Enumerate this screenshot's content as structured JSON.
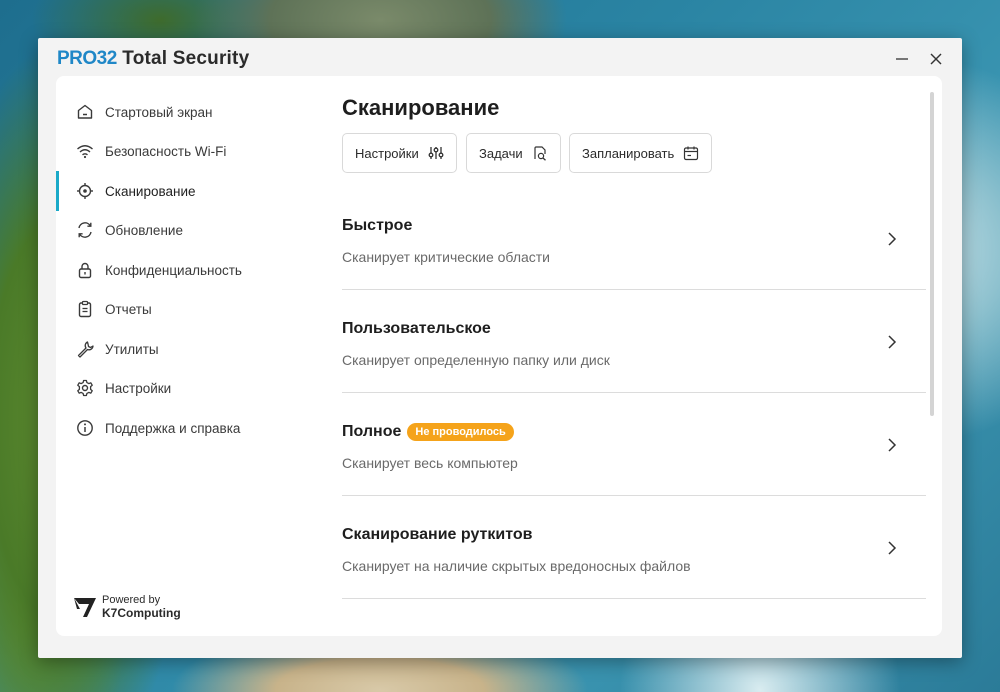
{
  "window": {
    "brand_pro": "PRO32",
    "brand_rest": "Total Security",
    "minimize_label": "—",
    "close_label": "✕"
  },
  "sidebar": {
    "items": [
      {
        "label": "Стартовый экран",
        "icon": "home-icon"
      },
      {
        "label": "Безопасность Wi-Fi",
        "icon": "wifi-icon"
      },
      {
        "label": "Сканирование",
        "icon": "scan-target-icon",
        "active": true
      },
      {
        "label": "Обновление",
        "icon": "refresh-icon"
      },
      {
        "label": "Конфиденциальность",
        "icon": "lock-icon"
      },
      {
        "label": "Отчеты",
        "icon": "clipboard-icon"
      },
      {
        "label": "Утилиты",
        "icon": "wrench-icon"
      },
      {
        "label": "Настройки",
        "icon": "gear-icon"
      },
      {
        "label": "Поддержка и справка",
        "icon": "info-icon"
      }
    ],
    "powered_by": "Powered by",
    "powered_company": "K7Computing"
  },
  "main": {
    "title": "Сканирование",
    "toolbar": {
      "settings": "Настройки",
      "tasks": "Задачи",
      "schedule": "Запланировать"
    },
    "scans": [
      {
        "name": "Быстрое",
        "desc": "Сканирует критические области"
      },
      {
        "name": "Пользовательское",
        "desc": "Сканирует определенную папку или диск"
      },
      {
        "name": "Полное",
        "desc": "Сканирует весь компьютер",
        "badge": "Не проводилось"
      },
      {
        "name": "Сканирование руткитов",
        "desc": "Сканирует на наличие скрытых вредоносных файлов"
      }
    ]
  },
  "colors": {
    "accent": "#1aa9c8",
    "brand_blue": "#1f87c7",
    "badge_orange": "#f5a31a"
  }
}
